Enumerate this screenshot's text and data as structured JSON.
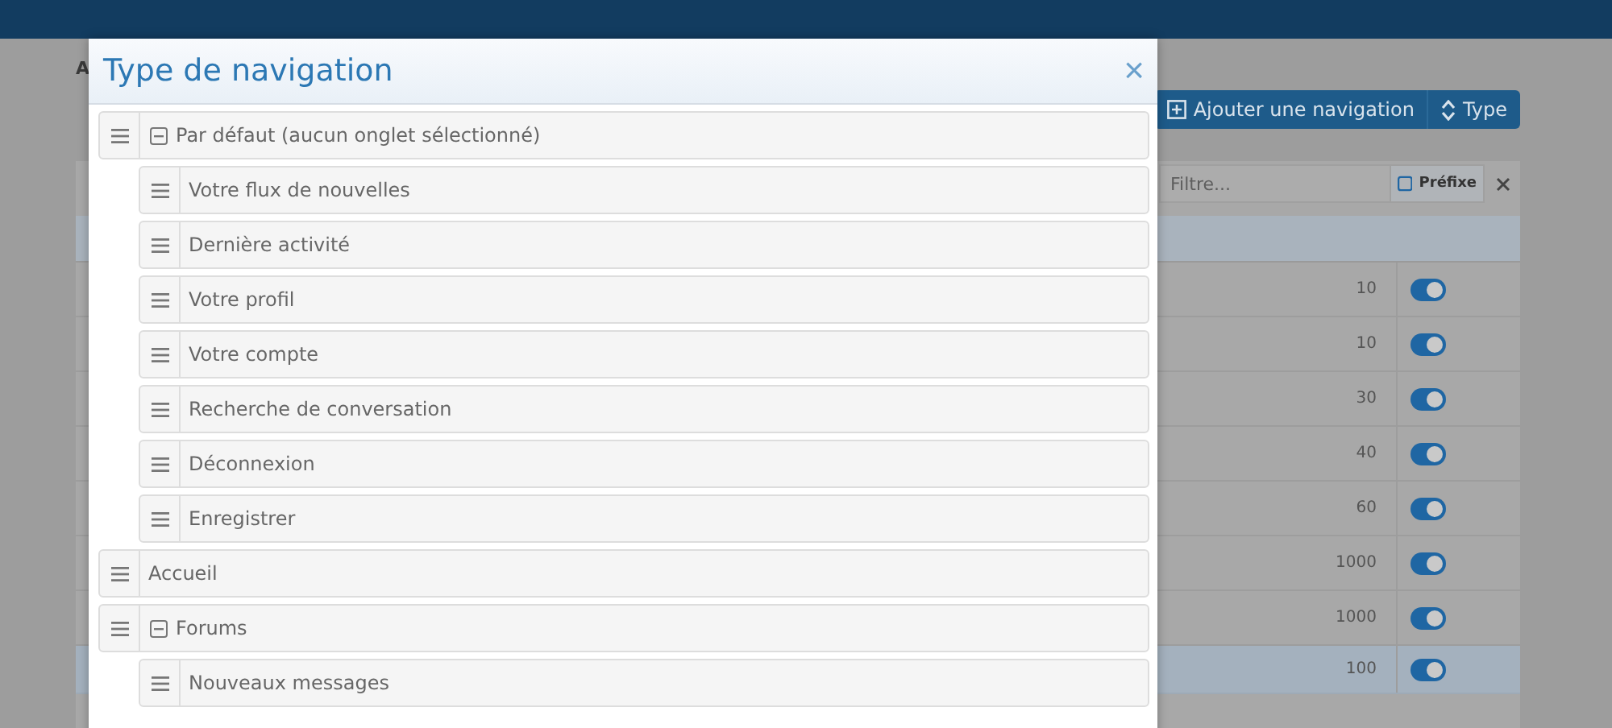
{
  "background": {
    "breadcrumb": "A",
    "buttons": [
      {
        "label": "Ajouter une navigation",
        "kind": "add"
      },
      {
        "label": "Type",
        "kind": "sort"
      }
    ],
    "filter": {
      "placeholder": "Filtre...",
      "prefix": {
        "label": "Préfixe",
        "checked": false
      }
    },
    "rows": [
      {
        "order": "10",
        "on": true,
        "selected": false
      },
      {
        "order": "10",
        "on": true,
        "selected": false
      },
      {
        "order": "30",
        "on": true,
        "selected": false
      },
      {
        "order": "40",
        "on": true,
        "selected": false
      },
      {
        "order": "60",
        "on": true,
        "selected": false
      },
      {
        "order": "1000",
        "on": true,
        "selected": false
      },
      {
        "order": "1000",
        "on": true,
        "selected": false
      },
      {
        "order": "100",
        "on": true,
        "selected": true
      }
    ]
  },
  "dialog": {
    "title": "Type de navigation",
    "close": "×",
    "items": [
      {
        "label": "Par défaut (aucun onglet sélectionné)",
        "expanded": true,
        "children": [
          {
            "label": "Votre flux de nouvelles"
          },
          {
            "label": "Dernière activité"
          },
          {
            "label": "Votre profil"
          },
          {
            "label": "Votre compte"
          },
          {
            "label": "Recherche de conversation"
          },
          {
            "label": "Déconnexion"
          },
          {
            "label": "Enregistrer"
          }
        ]
      },
      {
        "label": "Accueil"
      },
      {
        "label": "Forums",
        "expanded": true,
        "children": [
          {
            "label": "Nouveaux messages"
          }
        ]
      }
    ]
  }
}
